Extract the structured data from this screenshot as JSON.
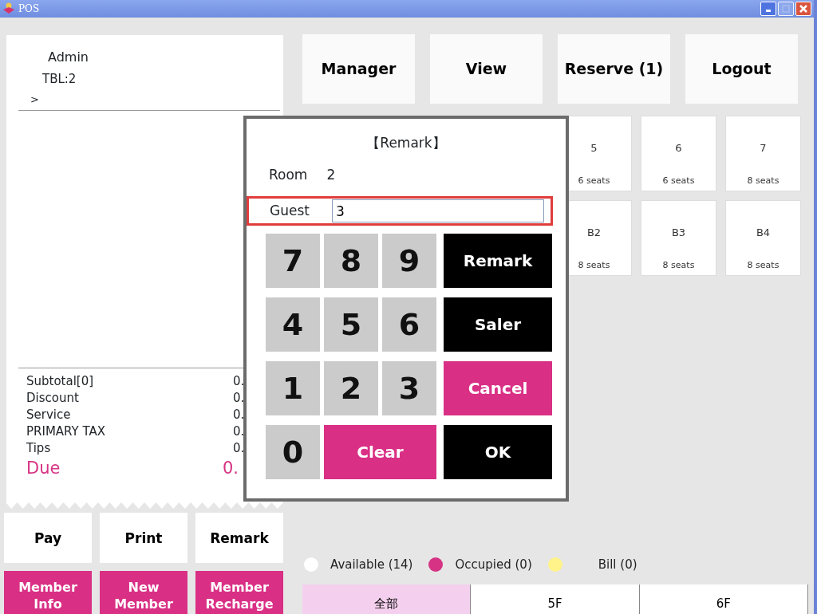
{
  "window": {
    "title": "POS"
  },
  "order": {
    "user": "Admin",
    "table": "TBL:2",
    "cursor": ">"
  },
  "summary": [
    {
      "label": "Subtotal[0]",
      "value": "0.",
      "kind": "line"
    },
    {
      "label": "Discount",
      "value": "0.",
      "kind": "line"
    },
    {
      "label": "Service",
      "value": "0.",
      "kind": "line"
    },
    {
      "label": "PRIMARY TAX",
      "value": "0.",
      "kind": "line"
    },
    {
      "label": "Tips",
      "value": "0.",
      "kind": "line"
    },
    {
      "label": "Due",
      "value": "0.",
      "kind": "due"
    }
  ],
  "actions": [
    {
      "label": "Pay",
      "kind": "plain"
    },
    {
      "label": "Print",
      "kind": "plain"
    },
    {
      "label": "Remark",
      "kind": "plain"
    },
    {
      "label": "Member Info",
      "kind": "accent"
    },
    {
      "label": "New Member",
      "kind": "accent"
    },
    {
      "label": "Member Recharge",
      "kind": "accent"
    }
  ],
  "top_buttons": [
    "Manager",
    "View",
    "Reserve (1)",
    "Logout"
  ],
  "tables": [
    {
      "name": "5",
      "seats": "6 seats"
    },
    {
      "name": "6",
      "seats": "6 seats"
    },
    {
      "name": "7",
      "seats": "8 seats"
    },
    {
      "name": "B2",
      "seats": "8 seats"
    },
    {
      "name": "B3",
      "seats": "8 seats"
    },
    {
      "name": "B4",
      "seats": "8 seats"
    }
  ],
  "dialog": {
    "title": "【Remark】",
    "room_label": "Room",
    "room_value": "2",
    "guest_label": "Guest",
    "guest_value": "3",
    "keys": [
      {
        "label": "7",
        "kind": "digit"
      },
      {
        "label": "8",
        "kind": "digit"
      },
      {
        "label": "9",
        "kind": "digit"
      },
      {
        "label": "Remark",
        "kind": "dark"
      },
      {
        "label": "4",
        "kind": "digit"
      },
      {
        "label": "5",
        "kind": "digit"
      },
      {
        "label": "6",
        "kind": "digit"
      },
      {
        "label": "Saler",
        "kind": "dark"
      },
      {
        "label": "1",
        "kind": "digit"
      },
      {
        "label": "2",
        "kind": "digit"
      },
      {
        "label": "3",
        "kind": "digit"
      },
      {
        "label": "Cancel",
        "kind": "accent"
      },
      {
        "label": "0",
        "kind": "digit"
      },
      {
        "label": "Clear",
        "kind": "accent_wide"
      },
      {
        "label": "OK",
        "kind": "dark"
      }
    ]
  },
  "legend": [
    {
      "label": "Available (14)",
      "color": "#ffffff"
    },
    {
      "label": "Occupied (0)",
      "color": "#d63384"
    },
    {
      "label": "Bill (0)",
      "color": "#fff38a"
    }
  ],
  "floors": [
    {
      "label": "全部",
      "selected": true
    },
    {
      "label": "5F",
      "selected": false
    },
    {
      "label": "6F",
      "selected": false
    }
  ]
}
